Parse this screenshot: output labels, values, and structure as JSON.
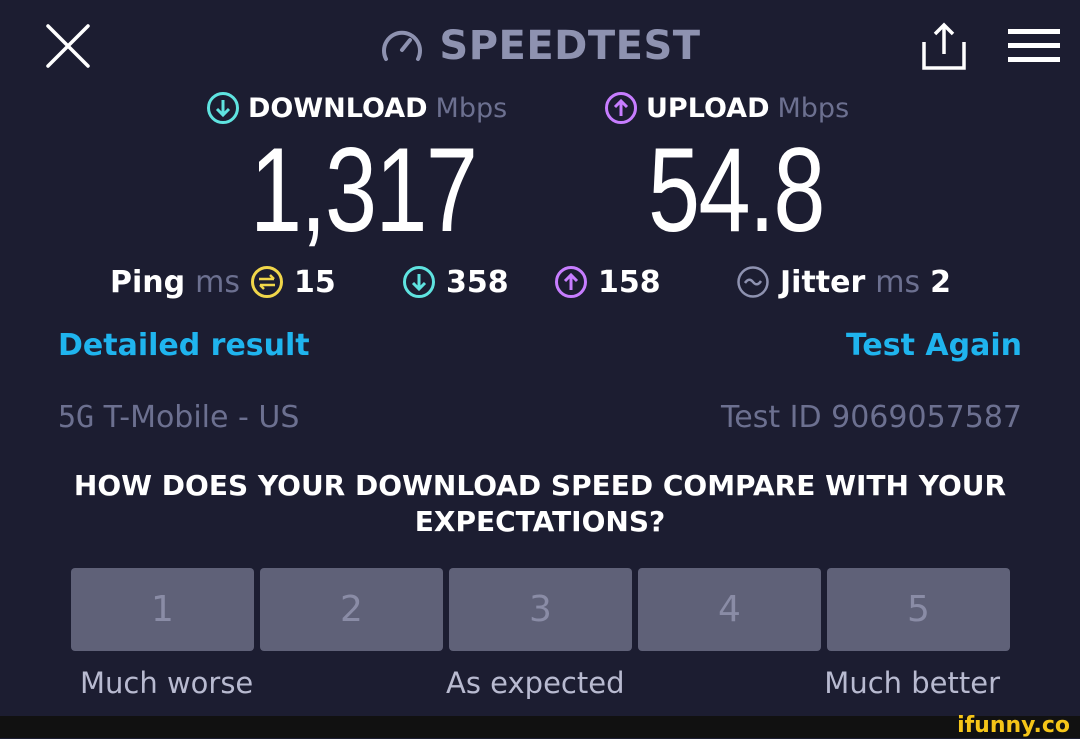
{
  "header": {
    "brand": "SPEEDTEST"
  },
  "download": {
    "label": "DOWNLOAD",
    "unit": "Mbps",
    "value": "1,317"
  },
  "upload": {
    "label": "UPLOAD",
    "unit": "Mbps",
    "value": "54.8"
  },
  "stats": {
    "ping_label": "Ping",
    "ping_unit": "ms",
    "ping_value": "15",
    "download_latency": "358",
    "upload_latency": "158",
    "jitter_label": "Jitter",
    "jitter_unit": "ms",
    "jitter_value": "2"
  },
  "actions": {
    "detailed": "Detailed result",
    "test_again": "Test Again"
  },
  "connection": {
    "network_type": "5G",
    "carrier": "T-Mobile - US",
    "test_id": "Test ID 9069057587"
  },
  "survey": {
    "question": "HOW DOES YOUR DOWNLOAD SPEED COMPARE WITH YOUR EXPECTATIONS?",
    "options": [
      "1",
      "2",
      "3",
      "4",
      "5"
    ],
    "low_label": "Much worse",
    "mid_label": "As expected",
    "high_label": "Much better"
  },
  "watermark": "ifunny.co",
  "colors": {
    "background": "#1c1d31",
    "link": "#1fb4ee",
    "download_accent": "#5fe3e0",
    "upload_accent": "#c77dff",
    "ping_accent": "#f0d64a",
    "muted": "#6c7090"
  }
}
